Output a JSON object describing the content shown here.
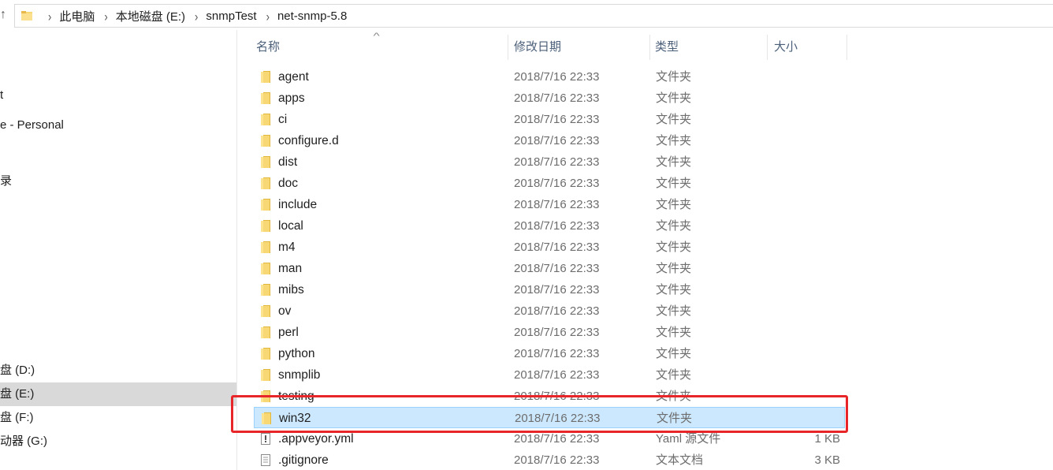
{
  "address_bar": {
    "up_arrow": "↑",
    "separator": "›",
    "crumbs": [
      "此电脑",
      "本地磁盘 (E:)",
      "snmpTest",
      "net-snmp-5.8"
    ]
  },
  "nav_pane": {
    "items": [
      {
        "label": "t"
      },
      {
        "label": "e - Personal"
      },
      {
        "label": "录"
      },
      {
        "label": "盘 (D:)"
      },
      {
        "label": "盘 (E:)"
      },
      {
        "label": "盘 (F:)"
      },
      {
        "label": "动器 (G:)"
      }
    ]
  },
  "columns": {
    "name": "名称",
    "date": "修改日期",
    "type": "类型",
    "size": "大小",
    "sort_indicator": "^"
  },
  "files": [
    {
      "name": "agent",
      "date": "2018/7/16 22:33",
      "type": "文件夹",
      "size": "",
      "icon": "folder-icon"
    },
    {
      "name": "apps",
      "date": "2018/7/16 22:33",
      "type": "文件夹",
      "size": "",
      "icon": "folder-icon"
    },
    {
      "name": "ci",
      "date": "2018/7/16 22:33",
      "type": "文件夹",
      "size": "",
      "icon": "folder-icon"
    },
    {
      "name": "configure.d",
      "date": "2018/7/16 22:33",
      "type": "文件夹",
      "size": "",
      "icon": "folder-icon"
    },
    {
      "name": "dist",
      "date": "2018/7/16 22:33",
      "type": "文件夹",
      "size": "",
      "icon": "folder-icon"
    },
    {
      "name": "doc",
      "date": "2018/7/16 22:33",
      "type": "文件夹",
      "size": "",
      "icon": "folder-icon"
    },
    {
      "name": "include",
      "date": "2018/7/16 22:33",
      "type": "文件夹",
      "size": "",
      "icon": "folder-icon"
    },
    {
      "name": "local",
      "date": "2018/7/16 22:33",
      "type": "文件夹",
      "size": "",
      "icon": "folder-icon"
    },
    {
      "name": "m4",
      "date": "2018/7/16 22:33",
      "type": "文件夹",
      "size": "",
      "icon": "folder-icon"
    },
    {
      "name": "man",
      "date": "2018/7/16 22:33",
      "type": "文件夹",
      "size": "",
      "icon": "folder-icon"
    },
    {
      "name": "mibs",
      "date": "2018/7/16 22:33",
      "type": "文件夹",
      "size": "",
      "icon": "folder-icon"
    },
    {
      "name": "ov",
      "date": "2018/7/16 22:33",
      "type": "文件夹",
      "size": "",
      "icon": "folder-icon"
    },
    {
      "name": "perl",
      "date": "2018/7/16 22:33",
      "type": "文件夹",
      "size": "",
      "icon": "folder-icon"
    },
    {
      "name": "python",
      "date": "2018/7/16 22:33",
      "type": "文件夹",
      "size": "",
      "icon": "folder-icon"
    },
    {
      "name": "snmplib",
      "date": "2018/7/16 22:33",
      "type": "文件夹",
      "size": "",
      "icon": "folder-icon"
    },
    {
      "name": "testing",
      "date": "2018/7/16 22:33",
      "type": "文件夹",
      "size": "",
      "icon": "folder-icon"
    },
    {
      "name": "win32",
      "date": "2018/7/16 22:33",
      "type": "文件夹",
      "size": "",
      "icon": "folder-icon"
    },
    {
      "name": ".appveyor.yml",
      "date": "2018/7/16 22:33",
      "type": "Yaml 源文件",
      "size": "1 KB",
      "icon": "yaml-file-icon"
    },
    {
      "name": ".gitignore",
      "date": "2018/7/16 22:33",
      "type": "文本文档",
      "size": "3 KB",
      "icon": "text-file-icon"
    }
  ],
  "colors": {
    "selection_fill": "#cce8ff",
    "selection_border": "#99d1ff",
    "annotation_red": "#e8262a",
    "folder_yellow": "#f8d775"
  }
}
